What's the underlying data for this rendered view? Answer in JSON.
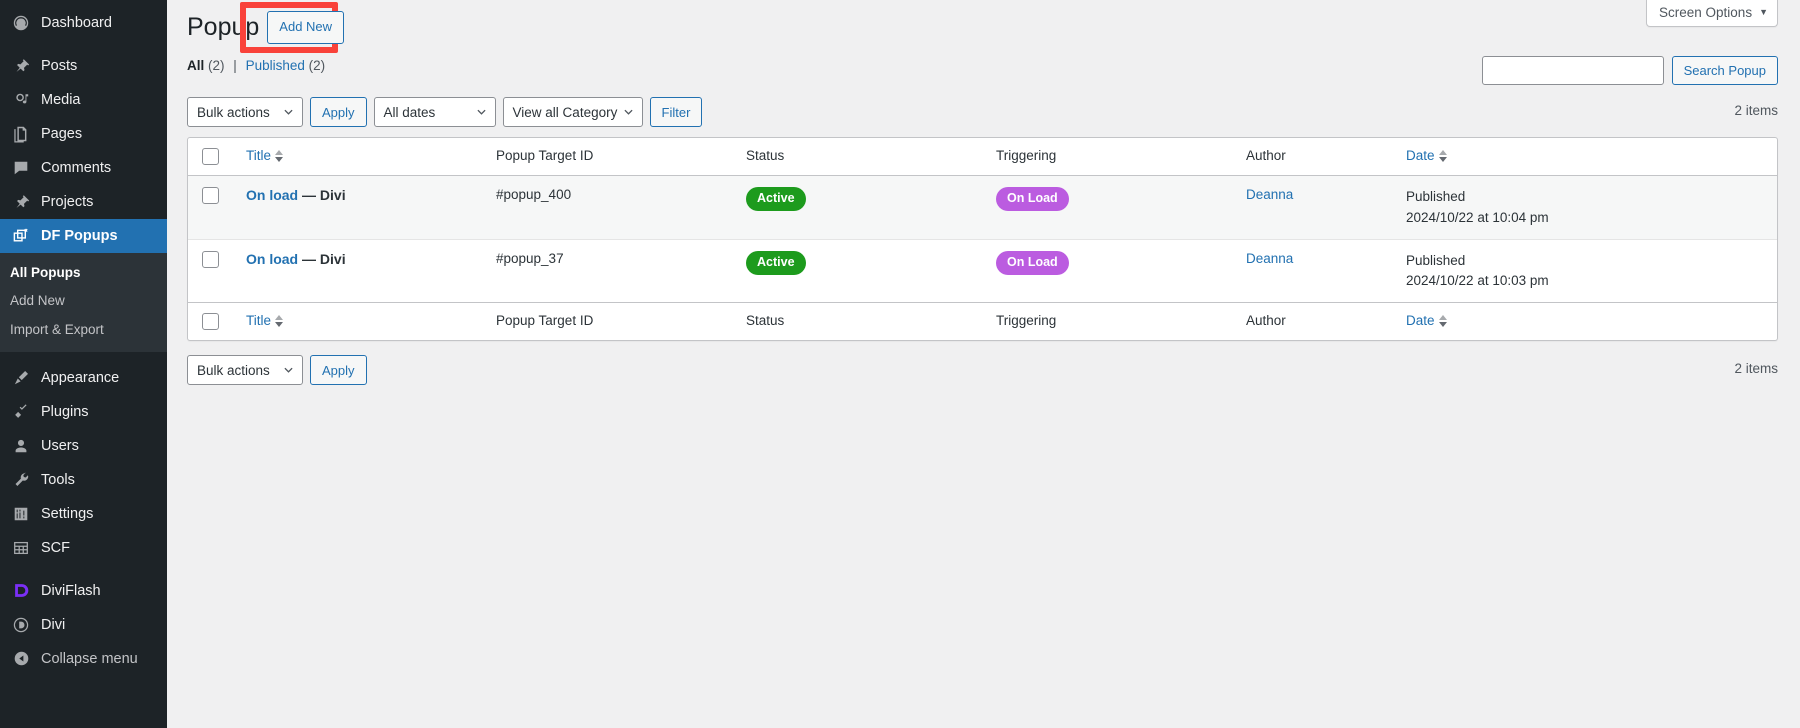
{
  "sidebar": {
    "items": [
      {
        "label": "Dashboard",
        "icon": "dashboard-icon",
        "current": false,
        "gap_after": true
      },
      {
        "label": "Posts",
        "icon": "pin-icon",
        "current": false,
        "gap_after": false
      },
      {
        "label": "Media",
        "icon": "media-icon",
        "current": false,
        "gap_after": false
      },
      {
        "label": "Pages",
        "icon": "pages-icon",
        "current": false,
        "gap_after": false
      },
      {
        "label": "Comments",
        "icon": "comments-icon",
        "current": false,
        "gap_after": false
      },
      {
        "label": "Projects",
        "icon": "pin-icon",
        "current": false,
        "gap_after": false
      },
      {
        "label": "DF Popups",
        "icon": "popups-icon",
        "current": true,
        "gap_after": false
      }
    ],
    "submenu": [
      {
        "label": "All Popups",
        "current": true
      },
      {
        "label": "Add New",
        "current": false
      },
      {
        "label": "Import & Export",
        "current": false
      }
    ],
    "items_lower": [
      {
        "label": "Appearance",
        "icon": "brush-icon",
        "current": false
      },
      {
        "label": "Plugins",
        "icon": "plug-icon",
        "current": false
      },
      {
        "label": "Users",
        "icon": "user-icon",
        "current": false
      },
      {
        "label": "Tools",
        "icon": "wrench-icon",
        "current": false
      },
      {
        "label": "Settings",
        "icon": "sliders-icon",
        "current": false
      },
      {
        "label": "SCF",
        "icon": "grid-icon",
        "current": false
      }
    ],
    "items_plugins": [
      {
        "label": "DiviFlash",
        "icon": "diviflash-icon",
        "current": false
      },
      {
        "label": "Divi",
        "icon": "divi-icon",
        "current": false
      }
    ],
    "collapse": {
      "label": "Collapse menu",
      "icon": "collapse-icon"
    }
  },
  "screen_options": {
    "label": "Screen Options",
    "caret": "▼"
  },
  "header": {
    "title": "Popup",
    "add_new_label": "Add New"
  },
  "views": {
    "all_label": "All",
    "all_count": "(2)",
    "separator": "|",
    "published_label": "Published",
    "published_count": "(2)"
  },
  "search": {
    "value": "",
    "placeholder": "",
    "button_label": "Search Popup"
  },
  "tablenav_top": {
    "bulk_actions": "Bulk actions",
    "apply_label": "Apply",
    "dates": "All dates",
    "category": "View all Category",
    "filter_label": "Filter",
    "items_count": "2 items"
  },
  "tablenav_bottom": {
    "bulk_actions": "Bulk actions",
    "apply_label": "Apply",
    "items_count": "2 items"
  },
  "table": {
    "columns": {
      "title": "Title",
      "target": "Popup Target ID",
      "status": "Status",
      "triggering": "Triggering",
      "author": "Author",
      "date": "Date"
    },
    "rows": [
      {
        "title": "On load",
        "title_dash": "—",
        "title_suffix": "Divi",
        "target": "#popup_400",
        "status": "Active",
        "triggering": "On Load",
        "author": "Deanna",
        "date_status": "Published",
        "date_value": "2024/10/22 at 10:04 pm"
      },
      {
        "title": "On load",
        "title_dash": "—",
        "title_suffix": "Divi",
        "target": "#popup_37",
        "status": "Active",
        "triggering": "On Load",
        "author": "Deanna",
        "date_status": "Published",
        "date_value": "2024/10/22 at 10:03 pm"
      }
    ]
  },
  "colors": {
    "accent_blue": "#2271b1",
    "sidebar_bg": "#1d2327",
    "submenu_bg": "#2c3338",
    "status_green": "#1d9b1d",
    "trigger_purple": "#bb5ce0",
    "highlight_red": "#f9423a",
    "page_bg": "#f0f0f1"
  }
}
